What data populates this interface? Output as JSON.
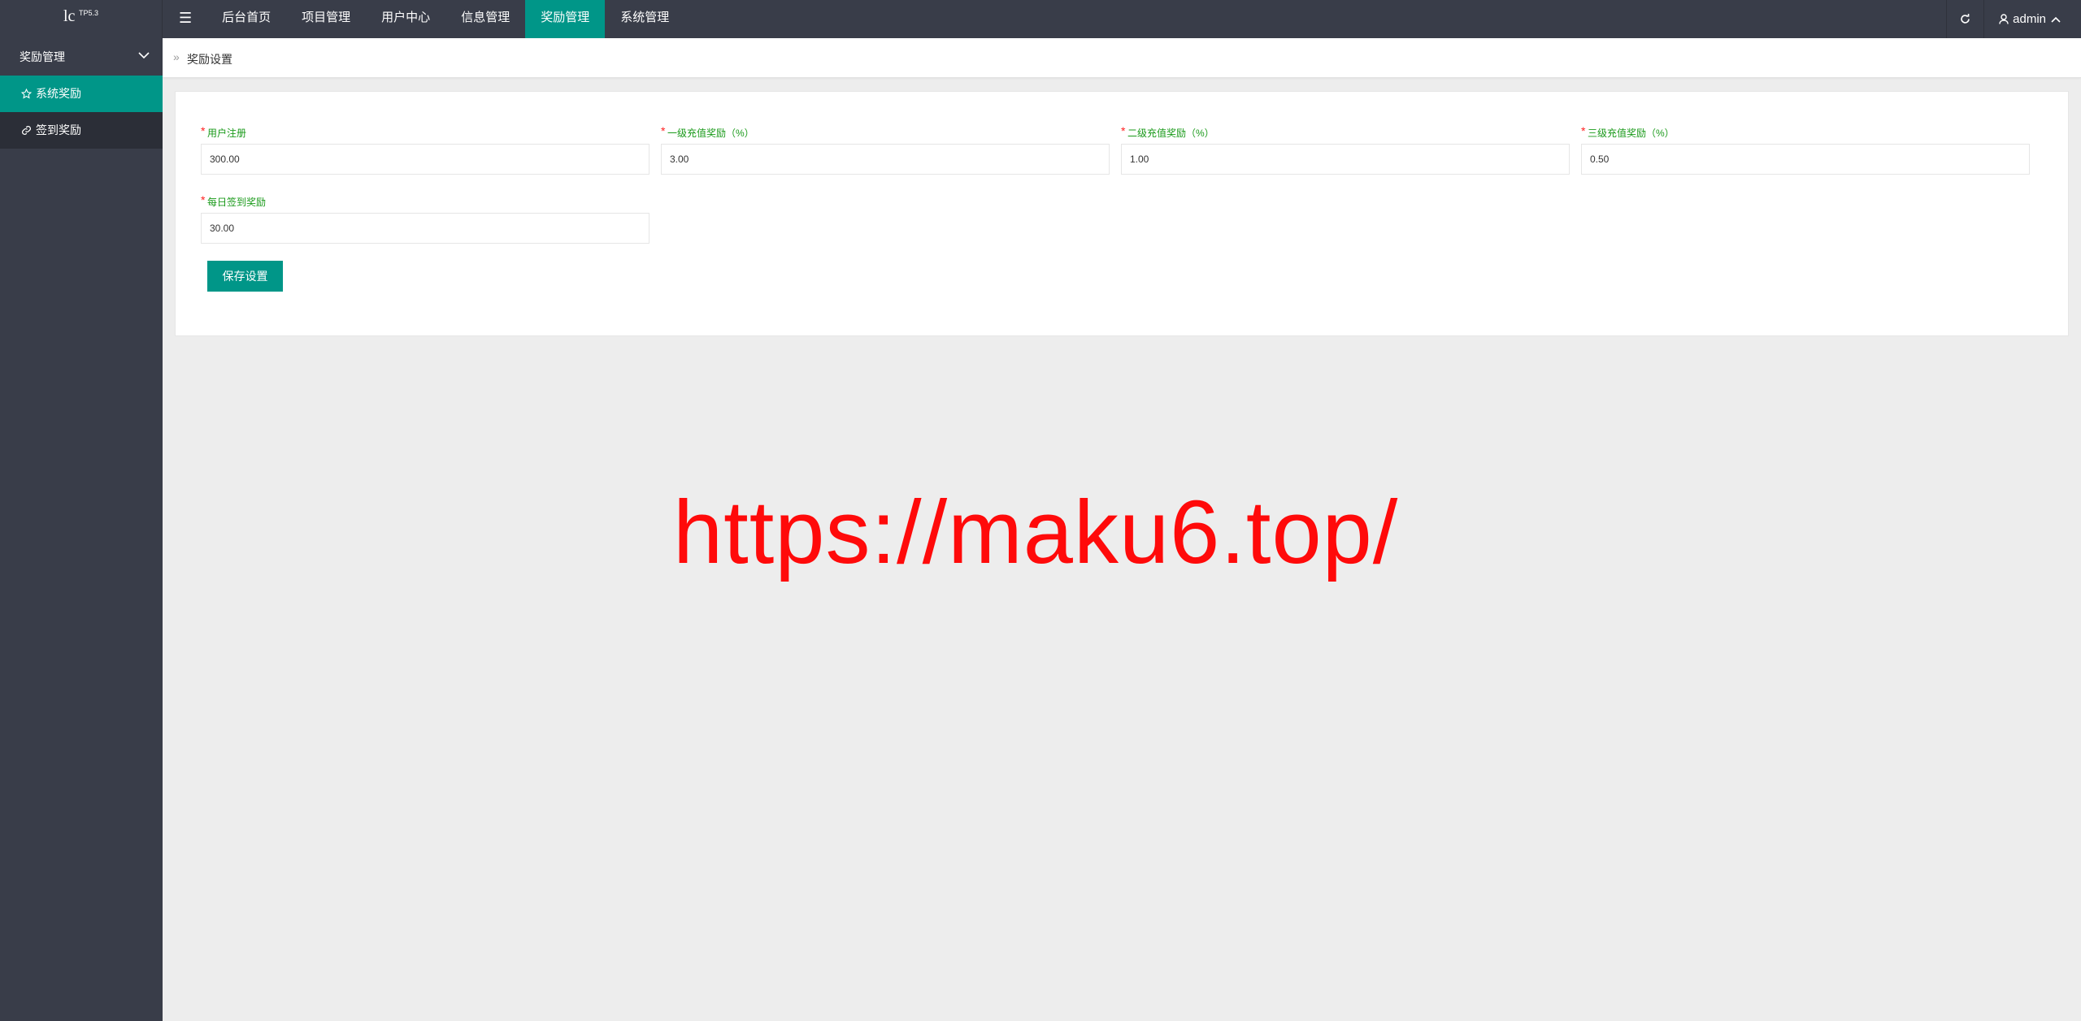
{
  "logo": {
    "main": "lc",
    "sup": "TP5.3"
  },
  "nav": {
    "toggle_icon": "menu-icon",
    "items": [
      {
        "label": "后台首页"
      },
      {
        "label": "项目管理"
      },
      {
        "label": "用户中心"
      },
      {
        "label": "信息管理"
      },
      {
        "label": "奖励管理",
        "active": true
      },
      {
        "label": "系统管理"
      }
    ]
  },
  "user": {
    "name": "admin"
  },
  "sidebar": {
    "group": "奖励管理",
    "items": [
      {
        "label": "系统奖励",
        "icon": "star-icon",
        "active": true
      },
      {
        "label": "签到奖励",
        "icon": "link-icon"
      }
    ]
  },
  "breadcrumb": {
    "sep": "»",
    "current": "奖励设置"
  },
  "form": {
    "fields": [
      {
        "label": "用户注册",
        "value": "300.00"
      },
      {
        "label": "一级充值奖励（%）",
        "value": "3.00"
      },
      {
        "label": "二级充值奖励（%）",
        "value": "1.00"
      },
      {
        "label": "三级充值奖励（%）",
        "value": "0.50"
      },
      {
        "label": "每日签到奖励",
        "value": "30.00"
      }
    ],
    "required_mark": "*",
    "save_label": "保存设置"
  },
  "watermark": "https://maku6.top/",
  "colors": {
    "accent": "#009688",
    "topbar": "#393d49",
    "label": "#1a9a1a",
    "watermark": "#ff0a0a"
  }
}
